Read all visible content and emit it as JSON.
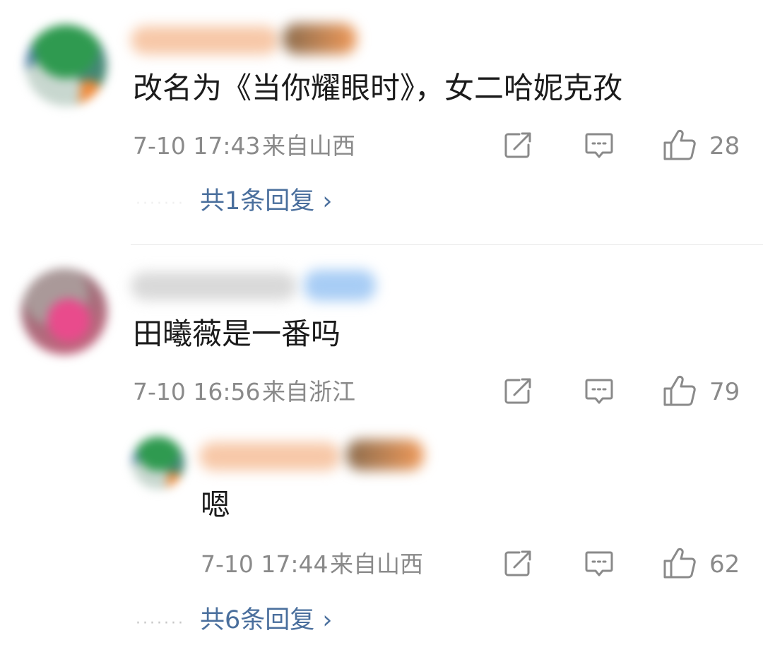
{
  "comments": [
    {
      "text": "改名为《当你耀眼时》，女二哈妮克孜",
      "time": "7-10 17:43",
      "location": "来自山西",
      "likes": "28",
      "replies_link": "共1条回复 ›"
    },
    {
      "text": "田曦薇是一番吗",
      "time": "7-10 16:56",
      "location": "来自浙江",
      "likes": "79"
    }
  ],
  "reply": {
    "text": "嗯",
    "time": "7-10 17:44",
    "location": "来自山西",
    "likes": "62"
  },
  "replies_link_2": "共6条回复 ›",
  "icons": [
    "share-icon",
    "comment-icon",
    "like-icon",
    "chevron-right-icon"
  ],
  "colors": {
    "link": "#4a6f9d",
    "meta": "#8a8a8a",
    "text": "#1b1b1b",
    "name_orange": "#f6c6a6",
    "name_blue_badge": "#9fc7f3"
  }
}
